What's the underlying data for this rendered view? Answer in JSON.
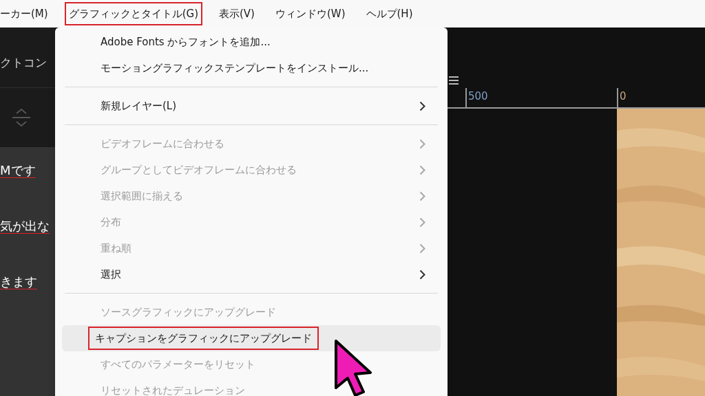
{
  "menu_bar": [
    {
      "label": "ーカー(M)",
      "annotated": false
    },
    {
      "label": "グラフィックとタイトル(G)",
      "annotated": true
    },
    {
      "label": "表示(V)",
      "annotated": false
    },
    {
      "label": "ウィンドウ(W)",
      "annotated": false
    },
    {
      "label": "ヘルプ(H)",
      "annotated": false
    }
  ],
  "left_panel": {
    "tab": "クトコン",
    "lines": [
      "Mです",
      "気が出な",
      "きます"
    ]
  },
  "ruler": {
    "labels": [
      "500",
      "0"
    ]
  },
  "menu": [
    {
      "kind": "item",
      "label": "Adobe Fonts からフォントを追加...",
      "disabled": false,
      "submenu": false,
      "hovered": false,
      "annotated": false
    },
    {
      "kind": "item",
      "label": "モーショングラフィックステンプレートをインストール...",
      "disabled": false,
      "submenu": false,
      "hovered": false,
      "annotated": false
    },
    {
      "kind": "separator"
    },
    {
      "kind": "item",
      "label": "新規レイヤー(L)",
      "disabled": false,
      "submenu": true,
      "hovered": false,
      "annotated": false
    },
    {
      "kind": "separator"
    },
    {
      "kind": "item",
      "label": "ビデオフレームに合わせる",
      "disabled": true,
      "submenu": true,
      "hovered": false,
      "annotated": false
    },
    {
      "kind": "item",
      "label": "グループとしてビデオフレームに合わせる",
      "disabled": true,
      "submenu": true,
      "hovered": false,
      "annotated": false
    },
    {
      "kind": "item",
      "label": "選択範囲に揃える",
      "disabled": true,
      "submenu": true,
      "hovered": false,
      "annotated": false
    },
    {
      "kind": "item",
      "label": "分布",
      "disabled": true,
      "submenu": true,
      "hovered": false,
      "annotated": false
    },
    {
      "kind": "item",
      "label": "重ね順",
      "disabled": true,
      "submenu": true,
      "hovered": false,
      "annotated": false
    },
    {
      "kind": "item",
      "label": "選択",
      "disabled": false,
      "submenu": true,
      "hovered": false,
      "annotated": false
    },
    {
      "kind": "separator"
    },
    {
      "kind": "item",
      "label": "ソースグラフィックにアップグレード",
      "disabled": true,
      "submenu": false,
      "hovered": false,
      "annotated": false
    },
    {
      "kind": "item",
      "label": "キャプションをグラフィックにアップグレード",
      "disabled": false,
      "submenu": false,
      "hovered": true,
      "annotated": true
    },
    {
      "kind": "item",
      "label": "すべてのパラメーターをリセット",
      "disabled": true,
      "submenu": false,
      "hovered": false,
      "annotated": false
    },
    {
      "kind": "item",
      "label": "リセットされたデュレーション",
      "disabled": true,
      "submenu": false,
      "hovered": false,
      "annotated": false
    }
  ]
}
